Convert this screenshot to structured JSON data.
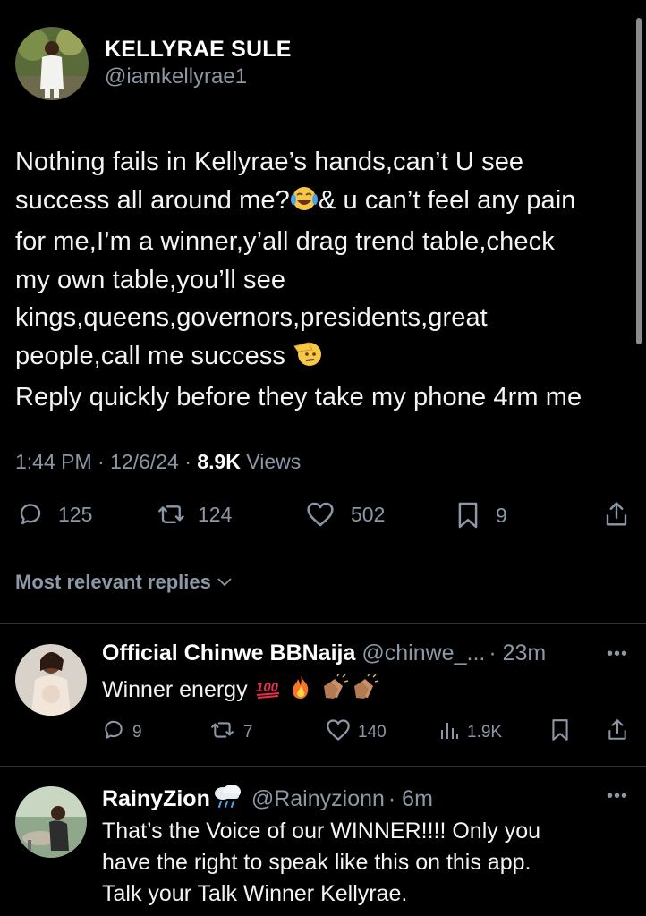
{
  "tweet": {
    "display_name": "KELLYRAE SULE",
    "handle": "@iamkellyrae1",
    "lines": [
      "Nothing fails in Kellyrae’s hands,can’t U see",
      "success all around me?",
      "& u can’t feel any pain",
      "for me,I’m a winner,y’all drag trend table,check",
      "my own table,you’ll see",
      "kings,queens,governors,presidents,great",
      "people,call me success ",
      "Reply quickly before they take my phone 4rm me"
    ],
    "time": "1:44 PM",
    "date": "12/6/24",
    "views_count": "8.9K",
    "views_label": "Views",
    "replies": "125",
    "reposts": "124",
    "likes": "502",
    "bookmarks": "9"
  },
  "replies_header": {
    "label": "Most relevant replies"
  },
  "replies": [
    {
      "name": "Official Chinwe BBNaija",
      "handle": "@chinwe_...",
      "time": "· 23m",
      "text": "Winner energy ",
      "replies": "9",
      "reposts": "7",
      "likes": "140",
      "views": "1.9K"
    },
    {
      "name": "RainyZion",
      "handle": "@Rainyzionn",
      "time": "· 6m",
      "lines": [
        "That’s the Voice of our WINNER!!!! Only you",
        "have the right to speak like this on this app.",
        "Talk your Talk Winner Kellyrae."
      ]
    }
  ],
  "icons": {
    "reply": "reply-icon",
    "repost": "repost-icon",
    "like": "heart-icon",
    "bookmark": "bookmark-icon",
    "share": "share-icon",
    "views": "views-icon",
    "more": "more-icon"
  },
  "colors": {
    "background": "#000000",
    "text": "#e7e9ea",
    "muted": "#8b98a5",
    "divider": "#2f3336"
  }
}
